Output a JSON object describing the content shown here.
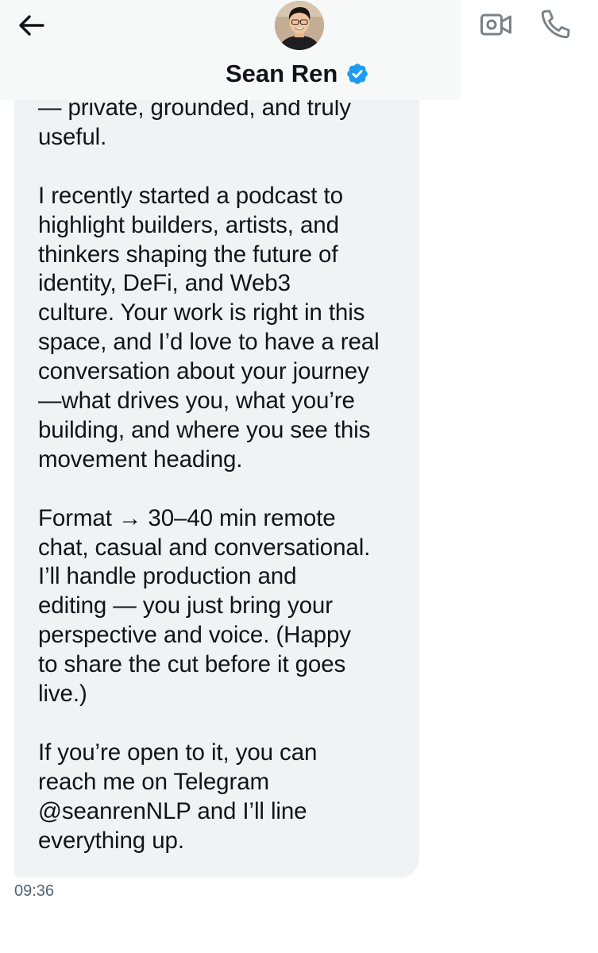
{
  "header": {
    "contact_name": "Sean Ren",
    "verified_color": "#1d9bf0",
    "icons": {
      "back": "arrow-left-icon",
      "video": "video-camera-icon",
      "phone": "phone-icon",
      "verified": "verified-badge-icon"
    }
  },
  "message": {
    "paragraphs": [
      {
        "lines": [
          "— private, grounded, and truly",
          "useful."
        ]
      },
      {
        "lines": [
          "I recently started a podcast to",
          "highlight builders, artists, and",
          "thinkers shaping the future of",
          "identity, DeFi, and Web3",
          "culture. Your work is right in this",
          "space, and I’d love to have a real",
          "conversation about your journey",
          "—what drives you, what you’re",
          "building, and where you see this",
          "movement heading."
        ]
      },
      {
        "lines": [
          "Format → 30–40 min remote",
          "chat, casual and conversational.",
          "I’ll handle production and",
          "editing — you just bring your",
          "perspective and voice. (Happy",
          "to share the cut before it goes",
          "live.)"
        ]
      },
      {
        "lines": [
          "If you’re open to it, you can",
          "reach me on Telegram",
          "@seanrenNLP and I’ll line",
          "everything up."
        ]
      }
    ],
    "timestamp": "09:36",
    "bubble_color": "#eff3f4"
  }
}
